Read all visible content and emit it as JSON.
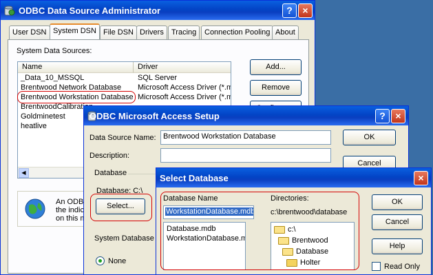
{
  "odbc_admin": {
    "title": "ODBC Data Source Administrator",
    "tabs": [
      "User DSN",
      "System DSN",
      "File DSN",
      "Drivers",
      "Tracing",
      "Connection Pooling",
      "About"
    ],
    "section_label": "System Data Sources:",
    "columns": [
      "Name",
      "Driver"
    ],
    "rows": [
      {
        "name": "_Data_10_MSSQL",
        "driver": "SQL Server"
      },
      {
        "name": "Brentwood Network Database",
        "driver": "Microsoft Access Driver (*.m"
      },
      {
        "name": "Brentwood Workstation Database",
        "driver": "Microsoft Access Driver (*.m"
      },
      {
        "name": "BrentwoodCalibration",
        "driver": ""
      },
      {
        "name": "Goldminetest",
        "driver": ""
      },
      {
        "name": "heatlive",
        "driver": ""
      }
    ],
    "buttons": {
      "add": "Add...",
      "remove": "Remove",
      "configure": "Configure..."
    },
    "info_text": [
      "An ODBC",
      "the indic",
      "on this m"
    ],
    "help_label": "?",
    "close_label": "×"
  },
  "access_setup": {
    "title": "ODBC Microsoft Access Setup",
    "dsn_label": "Data Source Name:",
    "dsn_value": "Brentwood Workstation Database",
    "description_label": "Description:",
    "description_value": "",
    "database_group": "Database",
    "database_path": "Database:  C:\\",
    "select_button": "Select...",
    "system_db_group": "System Database",
    "none_label": "None",
    "ok_button": "OK",
    "cancel_button": "Cancel",
    "help_label": "?",
    "close_label": "×"
  },
  "select_db": {
    "title": "Select Database",
    "dbname_label": "Database Name",
    "dbname_value": "WorkstationDatabase.mdb",
    "files": [
      "Database.mdb",
      "WorkstationDatabase.mdb"
    ],
    "directories_label": "Directories:",
    "current_dir": "c:\\brentwood\\database",
    "dirs": [
      "c:\\",
      "Brentwood",
      "Database",
      "Holter"
    ],
    "ok_button": "OK",
    "cancel_button": "Cancel",
    "help_button": "Help",
    "readonly_label": "Read Only",
    "close_label": "×"
  }
}
